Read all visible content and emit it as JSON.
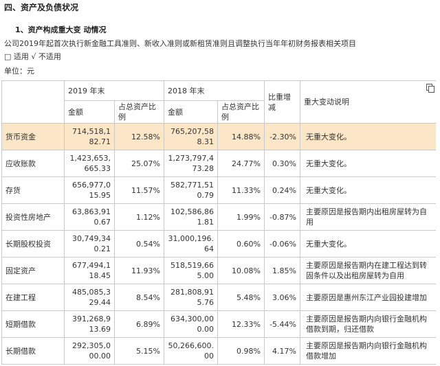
{
  "section_title": "四、资产及负债状况",
  "sub_title": "1、资产构成重大变 动情况",
  "notes": [
    "公司2019年起首次执行新金融工具准则、新收入准则或新租赁准则且调整执行当年年初财务报表相关项目",
    "□ 适用 √ 不适用",
    "单位：元"
  ],
  "table": {
    "header": {
      "year_2019": "2019 年末",
      "year_2018": "2018 年末",
      "change": "比重增减",
      "explanation": "重大变动说明",
      "amount": "金额",
      "ratio": "占总资产比例"
    },
    "rows": [
      {
        "item": "货币资金",
        "amt2019": "714,518,182.71",
        "pct2019": "12.58%",
        "amt2018": "765,207,588.31",
        "pct2018": "14.88%",
        "change": "-2.30%",
        "desc": "无重大变化。"
      },
      {
        "item": "应收账款",
        "amt2019": "1,423,653,665.33",
        "pct2019": "25.07%",
        "amt2018": "1,273,797,473.28",
        "pct2018": "24.77%",
        "change": "0.30%",
        "desc": "无重大变化。"
      },
      {
        "item": "存货",
        "amt2019": "656,977,015.95",
        "pct2019": "11.57%",
        "amt2018": "582,771,510.79",
        "pct2018": "11.33%",
        "change": "0.24%",
        "desc": "无重大变化。"
      },
      {
        "item": "投资性房地产",
        "amt2019": "63,863,910.67",
        "pct2019": "1.12%",
        "amt2018": "102,586,861.81",
        "pct2018": "1.99%",
        "change": "-0.87%",
        "desc": "主要原因是报告期内出租房屋转为自用"
      },
      {
        "item": "长期股权投资",
        "amt2019": "30,749,340.21",
        "pct2019": "0.54%",
        "amt2018": "31,000,196.64",
        "pct2018": "0.60%",
        "change": "-0.06%",
        "desc": "无重大变化。"
      },
      {
        "item": "固定资产",
        "amt2019": "677,494,118.45",
        "pct2019": "11.93%",
        "amt2018": "518,519,665.00",
        "pct2018": "10.08%",
        "change": "1.85%",
        "desc": "主要原因是报告期内在建工程达到转固条件以及出租房屋转为自用"
      },
      {
        "item": "在建工程",
        "amt2019": "485,085,329.44",
        "pct2019": "8.54%",
        "amt2018": "281,808,915.76",
        "pct2018": "5.48%",
        "change": "3.06%",
        "desc": "主要原因是惠州东江产业园投建增加"
      },
      {
        "item": "短期借款",
        "amt2019": "391,268,913.69",
        "pct2019": "6.89%",
        "amt2018": "634,300,000.00",
        "pct2018": "12.33%",
        "change": "-5.44%",
        "desc": "主要原因是报告期内向银行金融机构借款到期，归还借款"
      },
      {
        "item": "长期借款",
        "amt2019": "292,305,000.00",
        "pct2019": "5.15%",
        "amt2018": "50,266,600.00",
        "pct2018": "0.98%",
        "change": "4.17%",
        "desc": "主要原因是报告期内向银行金融机构借款增加"
      }
    ]
  }
}
